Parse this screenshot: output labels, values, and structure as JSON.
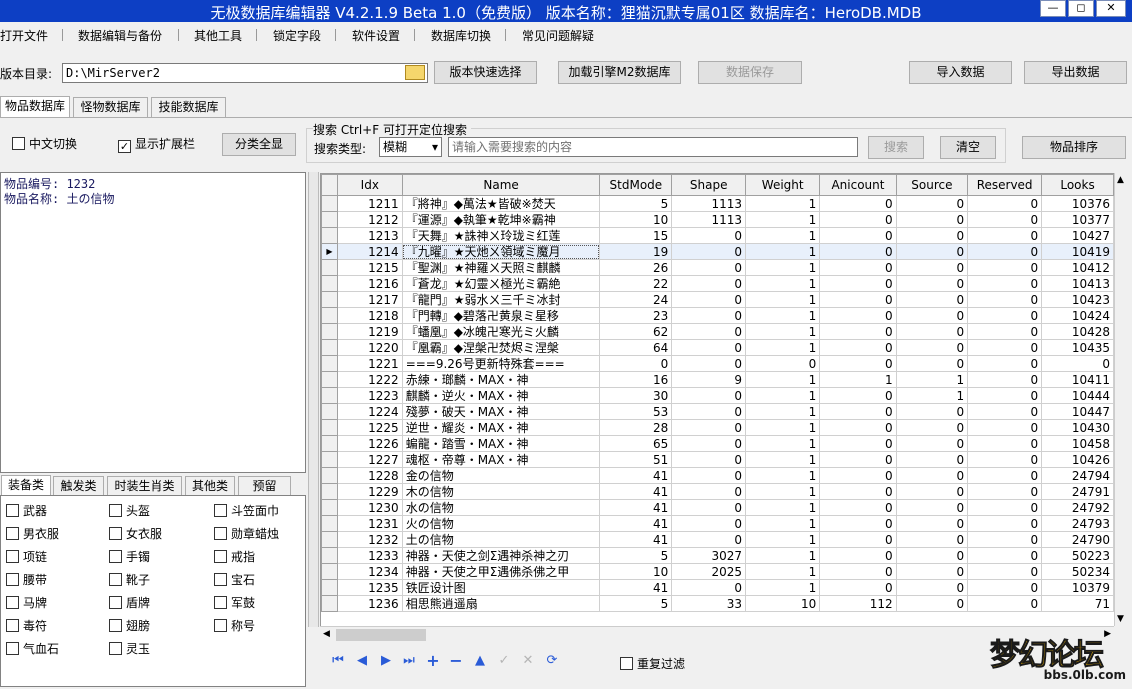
{
  "window": {
    "title": "无极数据库编辑器 V4.2.1.9   Beta 1.0（免费版）   版本名称：狸猫沉默专属01区   数据库名：HeroDB.MDB",
    "minimize": "—",
    "restore": "◻",
    "close": "✕"
  },
  "menu": [
    "打开文件",
    "数据编辑与备份",
    "其他工具",
    "锁定字段",
    "软件设置",
    "数据库切换",
    "常见问题解疑"
  ],
  "toolbar": {
    "dir_label": "版本目录:",
    "dir_value": "D:\\MirServer2",
    "quick_select": "版本快速选择",
    "load_m2": "加载引擎M2数据库",
    "save": "数据保存",
    "import": "导入数据",
    "export": "导出数据"
  },
  "db_tabs": [
    "物品数据库",
    "怪物数据库",
    "技能数据库"
  ],
  "options": {
    "chinese_switch": "中文切换",
    "show_ext": "显示扩展栏",
    "category_all": "分类全显"
  },
  "search": {
    "header": "搜索   Ctrl+F 可打开定位搜索",
    "type_label": "搜索类型:",
    "type_value": "模糊",
    "placeholder": "请输入需要搜索的内容",
    "search_btn": "搜索",
    "clear_btn": "清空",
    "sort_btn": "物品排序"
  },
  "item_info": {
    "id_line": "物品编号: 1232",
    "name_line": "物品名称: 土の信物"
  },
  "cat_tabs": [
    "装备类",
    "触发类",
    "时装生肖类",
    "其他类",
    "预留"
  ],
  "categories": [
    [
      "武器",
      "头盔",
      "斗笠面巾"
    ],
    [
      "男衣服",
      "女衣服",
      "勋章蜡烛"
    ],
    [
      "项链",
      "手镯",
      "戒指"
    ],
    [
      "腰带",
      "靴子",
      "宝石"
    ],
    [
      "马牌",
      "盾牌",
      "军鼓"
    ],
    [
      "毒符",
      "翅膀",
      "称号"
    ],
    [
      "气血石",
      "灵玉",
      ""
    ]
  ],
  "grid": {
    "columns": [
      "Idx",
      "Name",
      "StdMode",
      "Shape",
      "Weight",
      "Anicount",
      "Source",
      "Reserved",
      "Looks"
    ],
    "selected_idx": "1214",
    "rows": [
      [
        "1211",
        "『將神』◆萬法★皆破※焚天",
        "5",
        "1113",
        "1",
        "0",
        "0",
        "0",
        "10376"
      ],
      [
        "1212",
        "『運源』◆執筆★乾坤※霸神",
        "10",
        "1113",
        "1",
        "0",
        "0",
        "0",
        "10377"
      ],
      [
        "1213",
        "『天舞』★誅神ㄨ玲珑ミ红莲",
        "15",
        "0",
        "1",
        "0",
        "0",
        "0",
        "10427"
      ],
      [
        "1214",
        "『九曜』★天灺ㄨ領域ミ魔月",
        "19",
        "0",
        "1",
        "0",
        "0",
        "0",
        "10419"
      ],
      [
        "1215",
        "『聖渊』★神羅ㄨ天照ミ麒麟",
        "26",
        "0",
        "1",
        "0",
        "0",
        "0",
        "10412"
      ],
      [
        "1216",
        "『蒼龙』★幻靈ㄨ極光ミ霸絶",
        "22",
        "0",
        "1",
        "0",
        "0",
        "0",
        "10413"
      ],
      [
        "1217",
        "『龍門』★弱水ㄨ三千ミ冰封",
        "24",
        "0",
        "1",
        "0",
        "0",
        "0",
        "10423"
      ],
      [
        "1218",
        "『門轉』◆碧落卍黄泉ミ星移",
        "23",
        "0",
        "1",
        "0",
        "0",
        "0",
        "10424"
      ],
      [
        "1219",
        "『蟠凰』◆冰魄卍寒光ミ火麟",
        "62",
        "0",
        "1",
        "0",
        "0",
        "0",
        "10428"
      ],
      [
        "1220",
        "『凰霸』◆涅槃卍焚烬ミ涅槃",
        "64",
        "0",
        "1",
        "0",
        "0",
        "0",
        "10435"
      ],
      [
        "1221",
        "===9.26号更新特殊套===",
        "0",
        "0",
        "0",
        "0",
        "0",
        "0",
        "0"
      ],
      [
        "1222",
        "赤練・瑯麟・MAX・神",
        "16",
        "9",
        "1",
        "1",
        "1",
        "0",
        "10411"
      ],
      [
        "1223",
        "麒麟・逆火・MAX・神",
        "30",
        "0",
        "1",
        "0",
        "1",
        "0",
        "10444"
      ],
      [
        "1224",
        "殘夢・破天・MAX・神",
        "53",
        "0",
        "1",
        "0",
        "0",
        "0",
        "10447"
      ],
      [
        "1225",
        "逆世・耀炎・MAX・神",
        "28",
        "0",
        "1",
        "0",
        "0",
        "0",
        "10430"
      ],
      [
        "1226",
        "蝙龍・踏雪・MAX・神",
        "65",
        "0",
        "1",
        "0",
        "0",
        "0",
        "10458"
      ],
      [
        "1227",
        "魂枢・帝尊・MAX・神",
        "51",
        "0",
        "1",
        "0",
        "0",
        "0",
        "10426"
      ],
      [
        "1228",
        "金の信物",
        "41",
        "0",
        "1",
        "0",
        "0",
        "0",
        "24794"
      ],
      [
        "1229",
        "木の信物",
        "41",
        "0",
        "1",
        "0",
        "0",
        "0",
        "24791"
      ],
      [
        "1230",
        "水の信物",
        "41",
        "0",
        "1",
        "0",
        "0",
        "0",
        "24792"
      ],
      [
        "1231",
        "火の信物",
        "41",
        "0",
        "1",
        "0",
        "0",
        "0",
        "24793"
      ],
      [
        "1232",
        "土の信物",
        "41",
        "0",
        "1",
        "0",
        "0",
        "0",
        "24790"
      ],
      [
        "1233",
        "神器・天使之剑Σ遇神杀神之刃",
        "5",
        "3027",
        "1",
        "0",
        "0",
        "0",
        "50223"
      ],
      [
        "1234",
        "神器・天使之甲Σ遇佛杀佛之甲",
        "10",
        "2025",
        "1",
        "0",
        "0",
        "0",
        "50234"
      ],
      [
        "1235",
        "铁匠设计图",
        "41",
        "0",
        "1",
        "0",
        "0",
        "0",
        "10379"
      ],
      [
        "1236",
        "相思熊逍遥扇",
        "5",
        "33",
        "10",
        "112",
        "0",
        "0",
        "71"
      ]
    ]
  },
  "bottom": {
    "repeat_filter": "重复过滤",
    "nav_icons": [
      "first-icon",
      "prev-icon",
      "next-icon",
      "last-icon",
      "insert-icon",
      "delete-icon",
      "edit-icon",
      "post-icon",
      "cancel-icon",
      "refresh-icon"
    ]
  },
  "watermark": {
    "text": "梦幻论坛",
    "url": "bbs.0lb.com"
  },
  "colors": {
    "titlebar": "#0d3fc4",
    "accent": "#2a5bd7",
    "selected_row": "#e8f0fb"
  }
}
